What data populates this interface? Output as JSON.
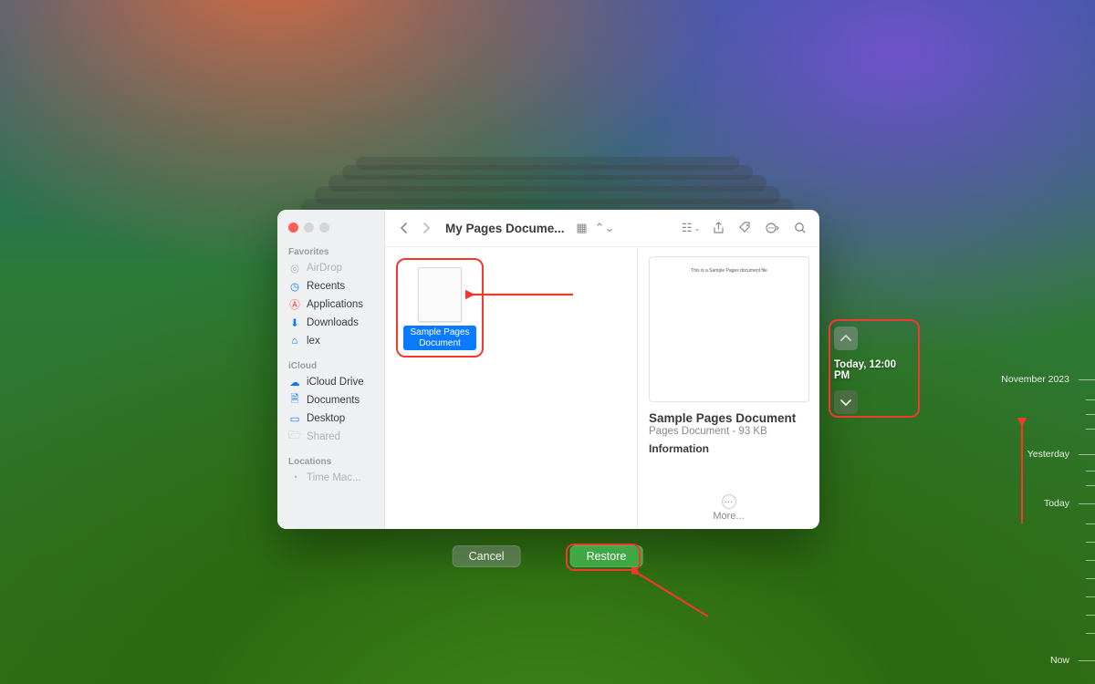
{
  "window": {
    "title": "My Pages Docume..."
  },
  "sidebar": {
    "sections": [
      {
        "header": "Favorites",
        "items": [
          {
            "icon": "airdrop-icon",
            "label": "AirDrop",
            "dim": true
          },
          {
            "icon": "clock-icon",
            "label": "Recents"
          },
          {
            "icon": "apps-icon",
            "label": "Applications"
          },
          {
            "icon": "download-icon",
            "label": "Downloads"
          },
          {
            "icon": "home-icon",
            "label": "lex"
          }
        ]
      },
      {
        "header": "iCloud",
        "items": [
          {
            "icon": "cloud-icon",
            "label": "iCloud Drive"
          },
          {
            "icon": "doc-icon",
            "label": "Documents"
          },
          {
            "icon": "desktop-icon",
            "label": "Desktop"
          },
          {
            "icon": "shared-icon",
            "label": "Shared",
            "dim": true
          }
        ]
      },
      {
        "header": "Locations",
        "items": [
          {
            "icon": "timemachine-icon",
            "label": "Time Mac...",
            "dim": true
          }
        ]
      }
    ]
  },
  "file": {
    "name": "Sample Pages Document"
  },
  "preview": {
    "thumb_text": "This is a Sample Pages document file",
    "name": "Sample Pages Document",
    "kind": "Pages Document - 93 KB",
    "info_label": "Information",
    "more_label": "More..."
  },
  "buttons": {
    "cancel": "Cancel",
    "restore": "Restore"
  },
  "timenav": {
    "label": "Today, 12:00 PM"
  },
  "timeline": {
    "labels": [
      "November 2023",
      "Yesterday",
      "Today",
      "Now"
    ]
  }
}
